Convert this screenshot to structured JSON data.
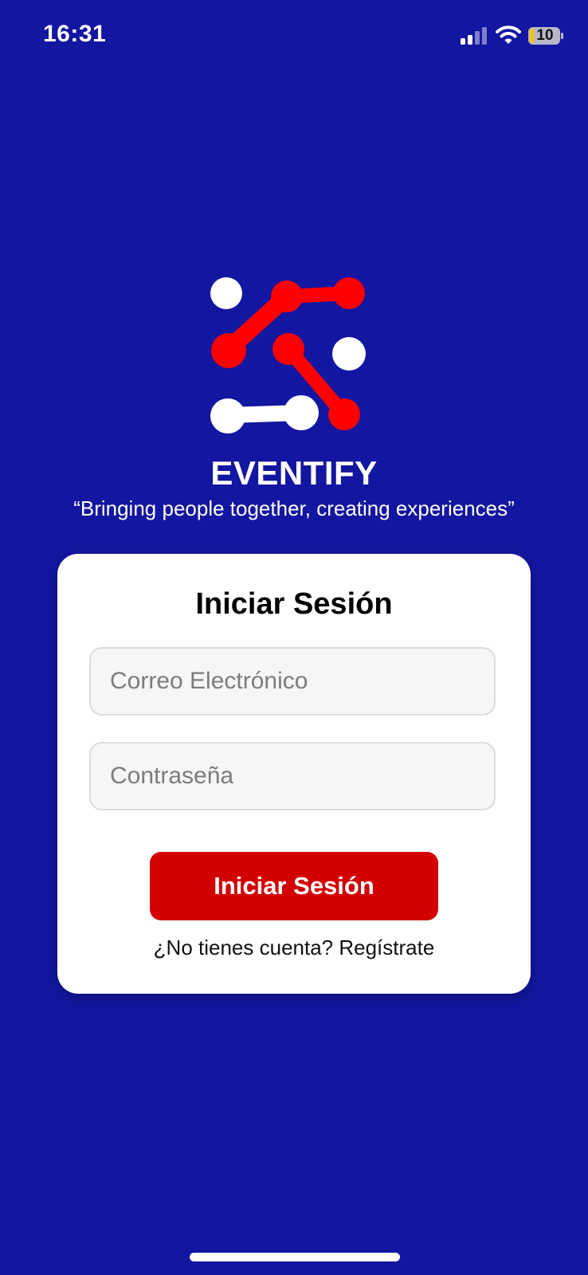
{
  "status_bar": {
    "time": "16:31",
    "battery": "10",
    "icons": [
      "signal-icon",
      "wifi-icon",
      "battery-icon"
    ]
  },
  "branding": {
    "app_name": "EVENTIFY",
    "tagline": "“Bringing people together, creating experiences”",
    "logo_colors": {
      "red": "#ff0000",
      "white": "#ffffff"
    }
  },
  "login": {
    "title": "Iniciar Sesión",
    "email_placeholder": "Correo Electrónico",
    "email_value": "",
    "password_placeholder": "Contraseña",
    "password_value": "",
    "submit_label": "Iniciar Sesión",
    "register_prompt": "¿No tienes cuenta? Regístrate"
  },
  "colors": {
    "background": "#1316a0",
    "card": "#ffffff",
    "button": "#d30000",
    "battery_fill": "#f5c400"
  }
}
